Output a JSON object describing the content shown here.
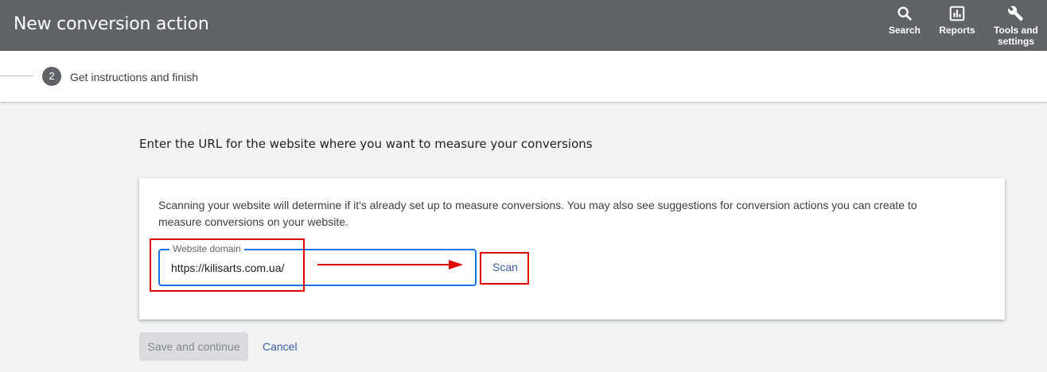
{
  "header": {
    "title": "New conversion action",
    "tools": [
      {
        "label": "Search",
        "icon": "search-icon"
      },
      {
        "label": "Reports",
        "icon": "reports-icon"
      },
      {
        "label": "Tools and settings",
        "icon": "wrench-icon"
      }
    ]
  },
  "stepper": {
    "step_number": "2",
    "step_label": "Get instructions and finish"
  },
  "main": {
    "heading": "Enter the URL for the website where you want to measure your conversions",
    "card": {
      "description": "Scanning your website will determine if it's already set up to measure conversions. You may also see suggestions for conversion actions you can create to measure conversions on your website.",
      "field_label": "Website domain",
      "field_value": "https://kilisarts.com.ua/",
      "scan_label": "Scan"
    },
    "save_label": "Save and continue",
    "cancel_label": "Cancel"
  },
  "colors": {
    "header_bg": "#5f6368",
    "accent": "#1a73e8",
    "link": "#3c5ea8",
    "annotation": "#e00000"
  }
}
